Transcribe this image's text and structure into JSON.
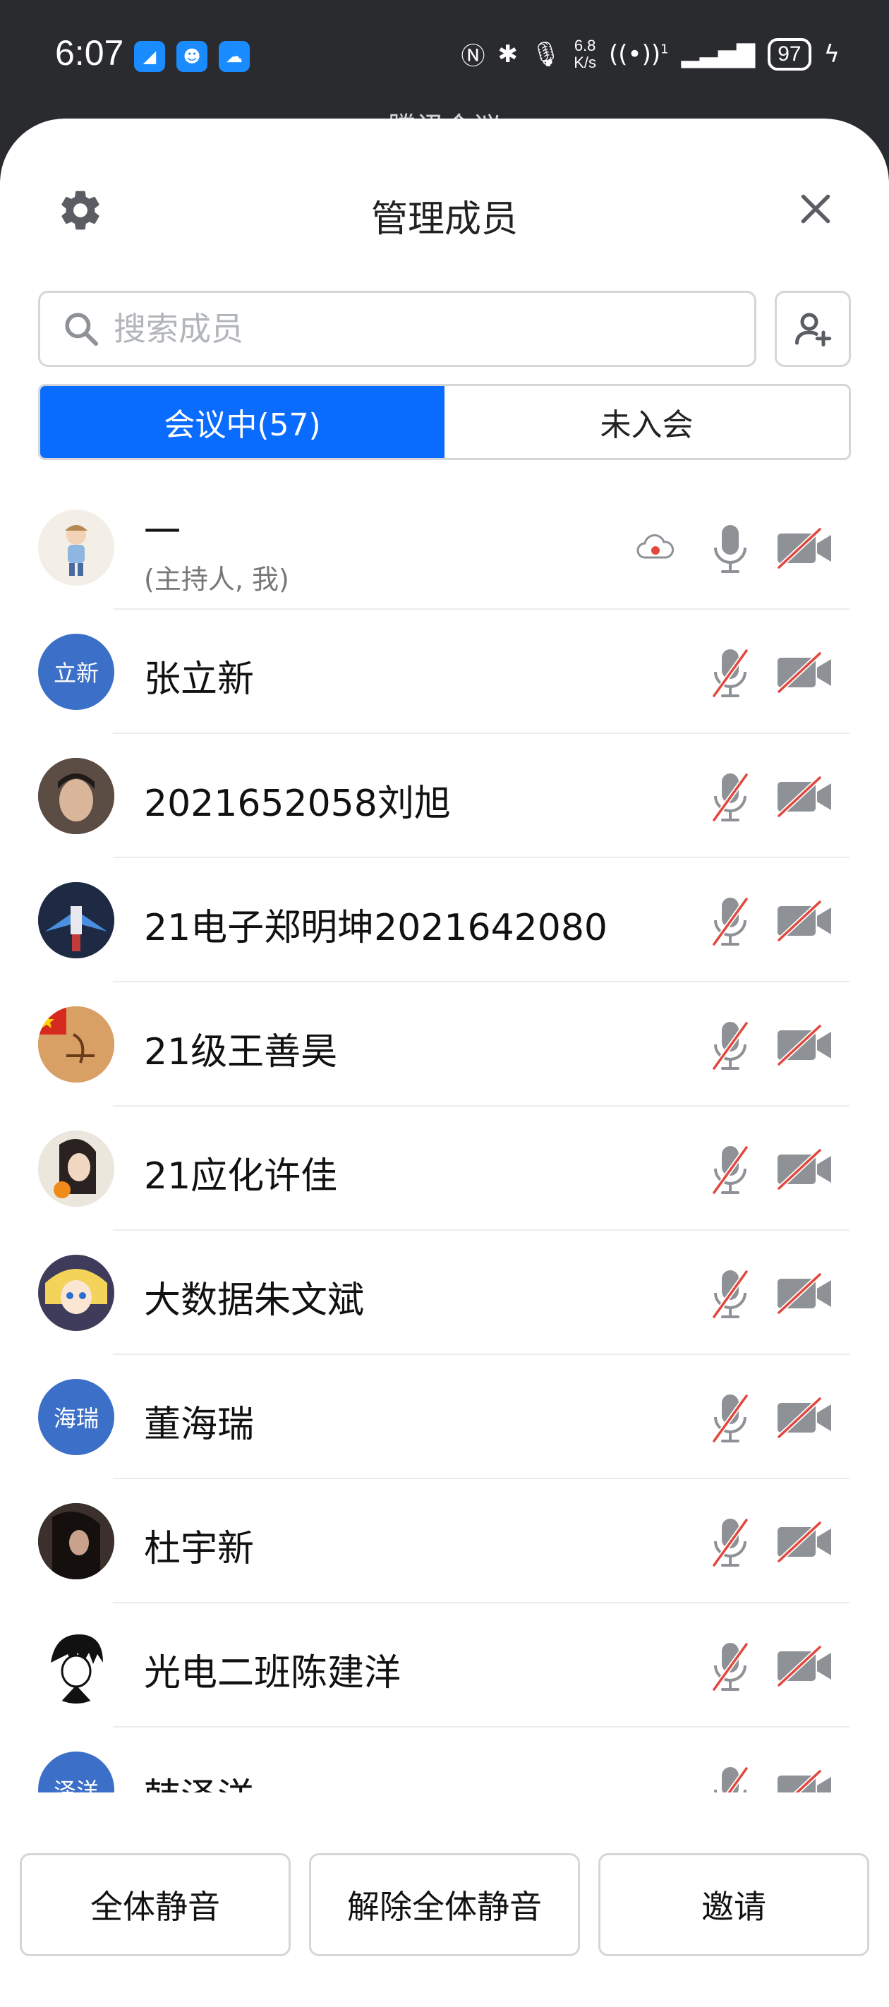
{
  "status_bar": {
    "time": "6:07",
    "net_speed_value": "6.8",
    "net_speed_unit": "K/s",
    "signal_sup": "1",
    "battery": "97",
    "icons": [
      "nfc-icon",
      "bluetooth-icon",
      "mic-icon",
      "hotspot-icon",
      "signal-icon",
      "charging-icon"
    ]
  },
  "background_title": "腾讯会议",
  "header": {
    "title": "管理成员"
  },
  "search": {
    "placeholder": "搜索成员"
  },
  "tabs": [
    {
      "label": "会议中(57)",
      "active": true
    },
    {
      "label": "未入会",
      "active": false
    }
  ],
  "members": [
    {
      "name": "一",
      "subtitle": "(主持人, 我)",
      "avatar": "image",
      "mic_on": true,
      "cam_on": false,
      "recording": true
    },
    {
      "name": "张立新",
      "avatar_text": "立新",
      "avatar": "text",
      "mic_on": false,
      "cam_on": false
    },
    {
      "name": "2021652058刘旭",
      "avatar": "image",
      "mic_on": false,
      "cam_on": false
    },
    {
      "name": "21电子郑明坤2021642080",
      "avatar": "image",
      "mic_on": false,
      "cam_on": false
    },
    {
      "name": "21级王善昊",
      "avatar": "image",
      "mic_on": false,
      "cam_on": false
    },
    {
      "name": "21应化许佳",
      "avatar": "image",
      "mic_on": false,
      "cam_on": false
    },
    {
      "name": "大数据朱文斌",
      "avatar": "image",
      "mic_on": false,
      "cam_on": false
    },
    {
      "name": "董海瑞",
      "avatar_text": "海瑞",
      "avatar": "text",
      "mic_on": false,
      "cam_on": false
    },
    {
      "name": "杜宇新",
      "avatar": "image",
      "mic_on": false,
      "cam_on": false
    },
    {
      "name": "光电二班陈建洋",
      "avatar": "image",
      "mic_on": false,
      "cam_on": false
    },
    {
      "name": "韩泽洋",
      "avatar_text": "泽洋",
      "avatar": "text",
      "mic_on": false,
      "cam_on": false
    }
  ],
  "footer": {
    "mute_all": "全体静音",
    "unmute_all": "解除全体静音",
    "invite": "邀请"
  },
  "colors": {
    "accent": "#0a6cff",
    "avatar_bg": "#3b6fc8",
    "off_slash": "#e0483e",
    "icon_gray": "#8e9196"
  }
}
